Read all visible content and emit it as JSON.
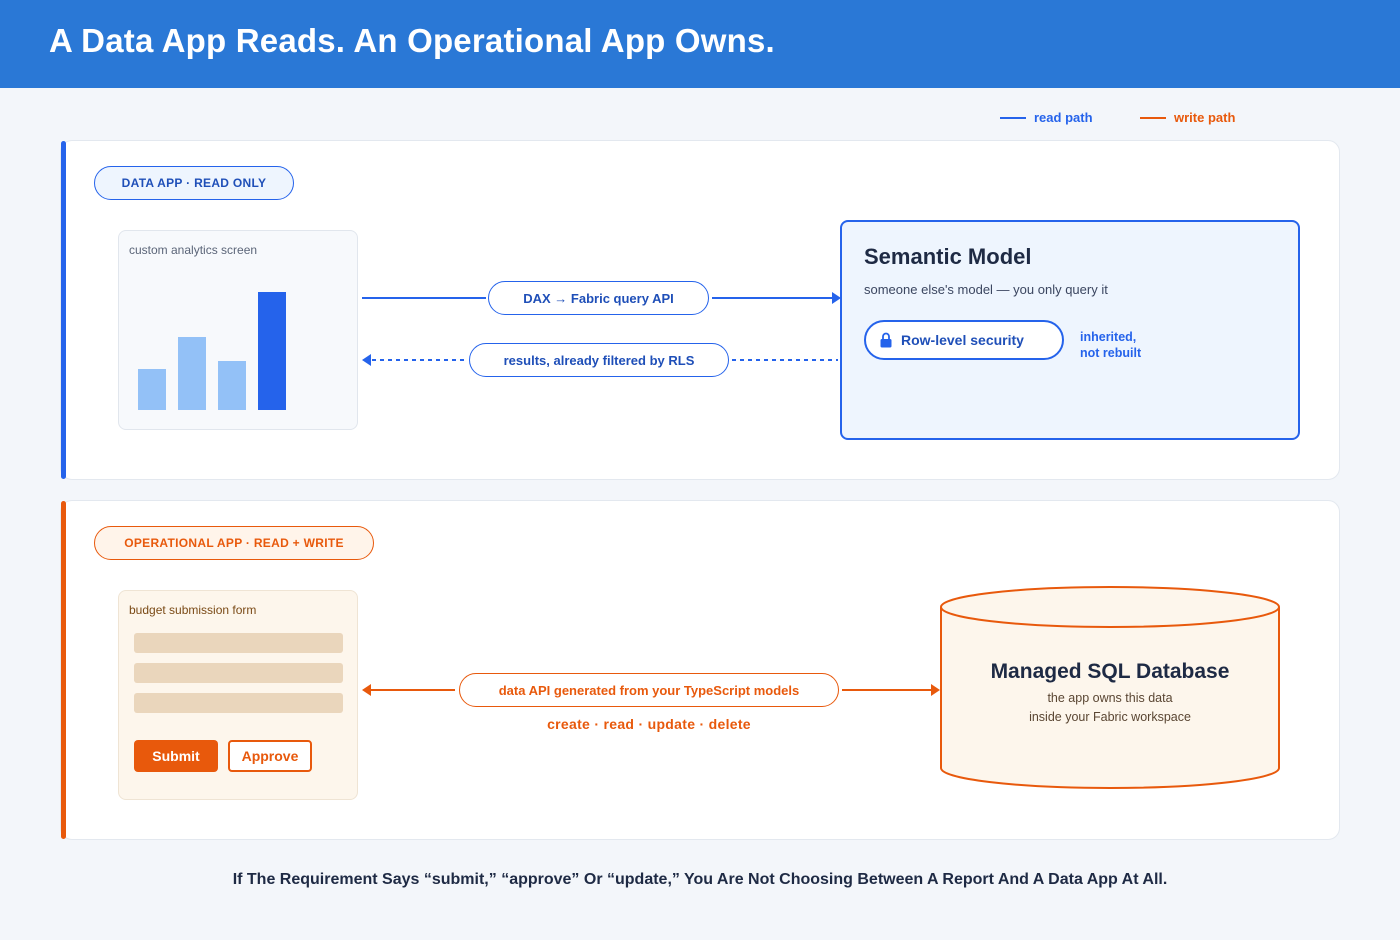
{
  "title": "A Data App Reads. An Operational App Owns.",
  "legend": {
    "read": {
      "label": "read path",
      "color": "#2563eb"
    },
    "write": {
      "label": "write path",
      "color": "#e8590c"
    }
  },
  "data_app": {
    "tag": "DATA APP · READ ONLY",
    "screen_label": "custom analytics screen",
    "bars": [
      {
        "level": 0.32,
        "accent": false
      },
      {
        "level": 0.57,
        "accent": false
      },
      {
        "level": 0.38,
        "accent": false
      },
      {
        "level": 0.92,
        "accent": true
      }
    ],
    "query_label": "DAX → Fabric query API",
    "results_label": "results, already filtered by RLS",
    "semantic_model": {
      "title": "Semantic Model",
      "subtitle": "someone else's model — you only query it",
      "rls_label": "Row-level security",
      "rls_note_1": "inherited,",
      "rls_note_2": "not rebuilt"
    }
  },
  "operational_app": {
    "tag": "OPERATIONAL APP · READ + WRITE",
    "form_label": "budget submission form",
    "submit_label": "Submit",
    "approve_label": "Approve",
    "api_label": "data API generated from your TypeScript models",
    "crud_label": "create · read · update · delete",
    "database": {
      "title": "Managed SQL Database",
      "line1": "the app owns this data",
      "line2": "inside your Fabric workspace"
    }
  },
  "footer": "If The Requirement Says “submit,” “approve” Or “update,” You Are Not Choosing Between A Report And A Data App At All."
}
